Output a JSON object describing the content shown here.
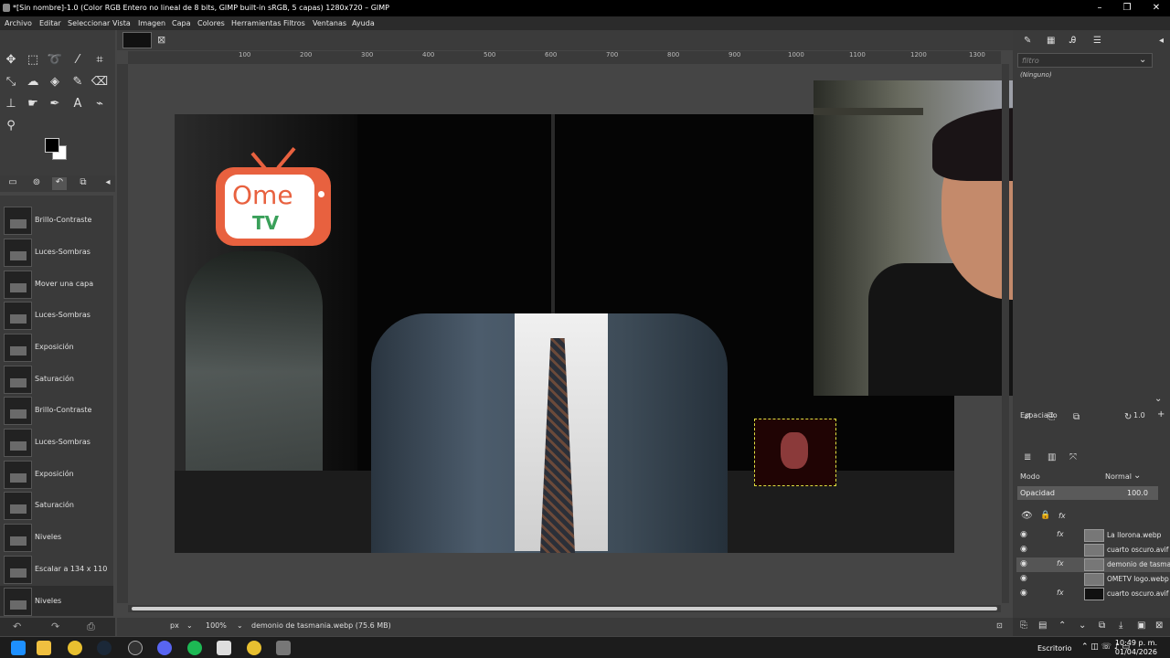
{
  "window": {
    "title": "*[Sin nombre]-1.0 (Color RGB Entero no lineal de 8 bits, GIMP built-in sRGB, 5 capas) 1280x720 – GIMP"
  },
  "menu": [
    "Archivo",
    "Editar",
    "Seleccionar",
    "Vista",
    "Imagen",
    "Capa",
    "Colores",
    "Herramientas",
    "Filtros",
    "Ventanas",
    "Ayuda"
  ],
  "history": [
    "Brillo-Contraste",
    "Luces-Sombras",
    "Mover una capa",
    "Luces-Sombras",
    "Exposición",
    "Saturación",
    "Brillo-Contraste",
    "Luces-Sombras",
    "Exposición",
    "Saturación",
    "Niveles",
    "Escalar a 134 x 110",
    "Niveles"
  ],
  "ruler": [
    "100",
    "200",
    "300",
    "400",
    "500",
    "600",
    "700",
    "800",
    "900",
    "1000",
    "1100",
    "1200",
    "1300"
  ],
  "logo": {
    "ome": "Ome",
    "tv": "TV"
  },
  "status": {
    "unit": "px",
    "zoom": "100%",
    "info": "demonio de tasmania.webp (75.6 MB)"
  },
  "right": {
    "filter_placeholder": "filtro",
    "none": "(Ninguno)",
    "spacing_label": "Espaciado",
    "spacing_value": "1.0",
    "mode_label": "Modo",
    "mode_value": "Normal",
    "opacity_label": "Opacidad",
    "opacity_value": "100.0"
  },
  "layers": [
    {
      "name": "La llorona.webp",
      "fx": true
    },
    {
      "name": "cuarto oscuro.avif (",
      "fx": false
    },
    {
      "name": "demonio de tasmania",
      "fx": true
    },
    {
      "name": "OMETV logo.webp",
      "fx": false
    },
    {
      "name": "cuarto oscuro.avif",
      "fx": true
    }
  ],
  "taskbar": {
    "desktop": "Escritorio",
    "time": "10:49 p. m.",
    "date": "01/04/2026"
  }
}
